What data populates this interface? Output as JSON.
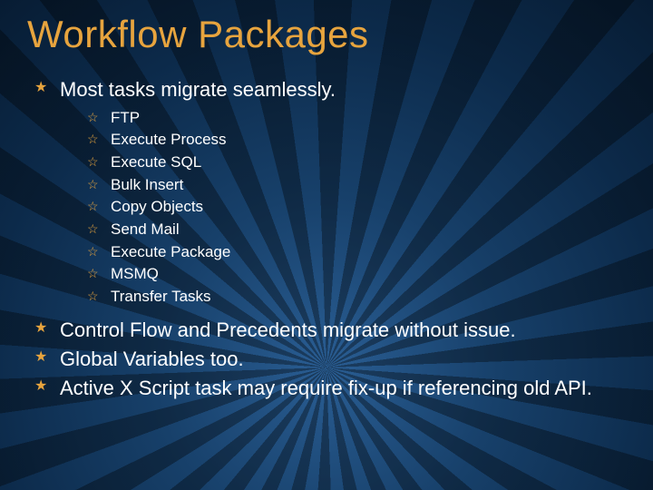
{
  "title": "Workflow Packages",
  "bullets": [
    {
      "text": "Most tasks migrate seamlessly.",
      "sub": [
        "FTP",
        "Execute Process",
        "Execute SQL",
        "Bulk Insert",
        "Copy Objects",
        "Send Mail",
        "Execute Package",
        "MSMQ",
        "Transfer Tasks"
      ]
    },
    {
      "text": "Control Flow and Precedents migrate without issue."
    },
    {
      "text": "Global Variables too."
    },
    {
      "text": "Active X Script task may require fix-up if referencing old API."
    }
  ]
}
